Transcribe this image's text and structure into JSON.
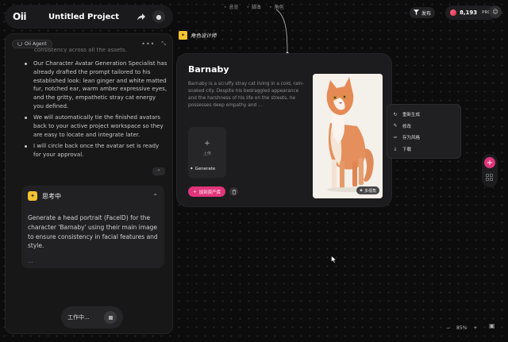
{
  "app": {
    "logo": "Oii",
    "project_title": "Untitled Project"
  },
  "nav_center": [
    "总览",
    "脚本",
    "角色"
  ],
  "top_right": {
    "publish_label": "发布",
    "credits": "8,193",
    "plan": "PRO"
  },
  "agent_panel": {
    "agent_label": "Oii Agent",
    "partial_line": "consistency across all the assets.",
    "bullets": [
      "Our Character Avatar Generation Specialist has already drafted the prompt tailored to his established look: lean ginger and white matted fur, notched ear, warm amber expressive eyes, and the gritty, empathetic stray cat energy you defined.",
      "We will automatically tie the finished avatars back to your active project workspace so they are easy to locate and integrate later.",
      "I will circle back once the avatar set is ready for your approval."
    ],
    "thinking": {
      "title": "思考中",
      "body": "Generate a head portrait (FaceID) for the character 'Barnaby' using their main image to ensure consistency in facial features and style.",
      "ellipsis": "..."
    },
    "working_label": "工作中..."
  },
  "canvas": {
    "role_tag": "角色设计师",
    "character": {
      "name": "Barnaby",
      "description": "Barnaby is a scruffy stray cat living in a cold, rain-soaked city. Despite his bedraggled appearance and the harshness of his life on the streets, he possesses deep empathy and ...",
      "upload_label": "上传",
      "generate_label": "Generate",
      "add_asset_label": "加到资产库",
      "multi_view_label": "多视角"
    },
    "context_menu": [
      {
        "icon": "regenerate-icon",
        "label": "重新生成"
      },
      {
        "icon": "edit-icon",
        "label": "修改"
      },
      {
        "icon": "style-icon",
        "label": "存为风格"
      },
      {
        "icon": "download-icon",
        "label": "下载"
      }
    ]
  },
  "zoom": {
    "minus": "−",
    "level": "85%",
    "plus": "+"
  },
  "colors": {
    "accent": "#e0357a",
    "bulb": "#f2c230",
    "panel": "#171718",
    "canvas_bg": "#0c0c0d"
  }
}
